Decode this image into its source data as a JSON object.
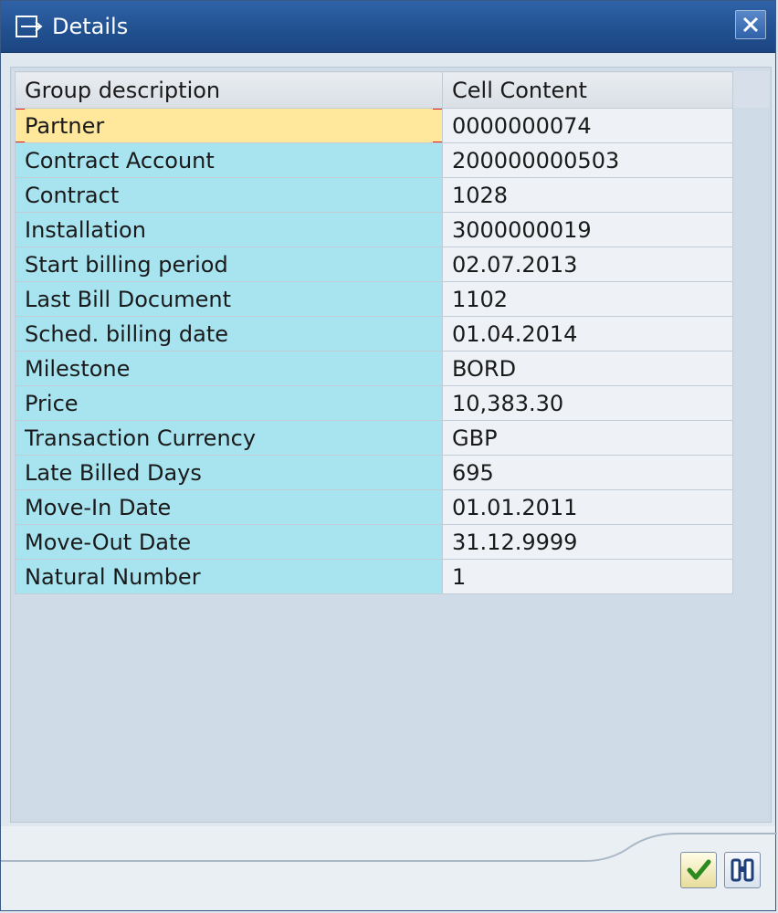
{
  "window": {
    "title": "Details",
    "title_icon": "details-icon",
    "close_icon": "close-icon"
  },
  "table": {
    "columns": [
      "Group description",
      "Cell Content"
    ],
    "rows": [
      {
        "label": "Partner",
        "value": "0000000074"
      },
      {
        "label": "Contract Account",
        "value": "200000000503"
      },
      {
        "label": "Contract",
        "value": "1028"
      },
      {
        "label": "Installation",
        "value": "3000000019"
      },
      {
        "label": "Start billing period",
        "value": "02.07.2013"
      },
      {
        "label": "Last Bill Document",
        "value": "1102"
      },
      {
        "label": "Sched. billing date",
        "value": "01.04.2014"
      },
      {
        "label": "Milestone",
        "value": "BORD"
      },
      {
        "label": "Price",
        "value": "10,383.30"
      },
      {
        "label": "Transaction Currency",
        "value": "GBP"
      },
      {
        "label": "Late Billed Days",
        "value": "695"
      },
      {
        "label": "Move-In Date",
        "value": "01.01.2011"
      },
      {
        "label": "Move-Out Date",
        "value": "31.12.9999"
      },
      {
        "label": "Natural Number",
        "value": "1"
      }
    ]
  },
  "footer": {
    "buttons": [
      {
        "icon": "checkmark-icon",
        "color": "#2d8a1e"
      },
      {
        "icon": "binoculars-icon",
        "color": "#1f3f7a"
      }
    ]
  },
  "colors": {
    "title_bar": "#21508f",
    "description_cell": "#a8e4f0",
    "selected_cell": "#ffe79c",
    "selection_marker": "#d8222a"
  }
}
